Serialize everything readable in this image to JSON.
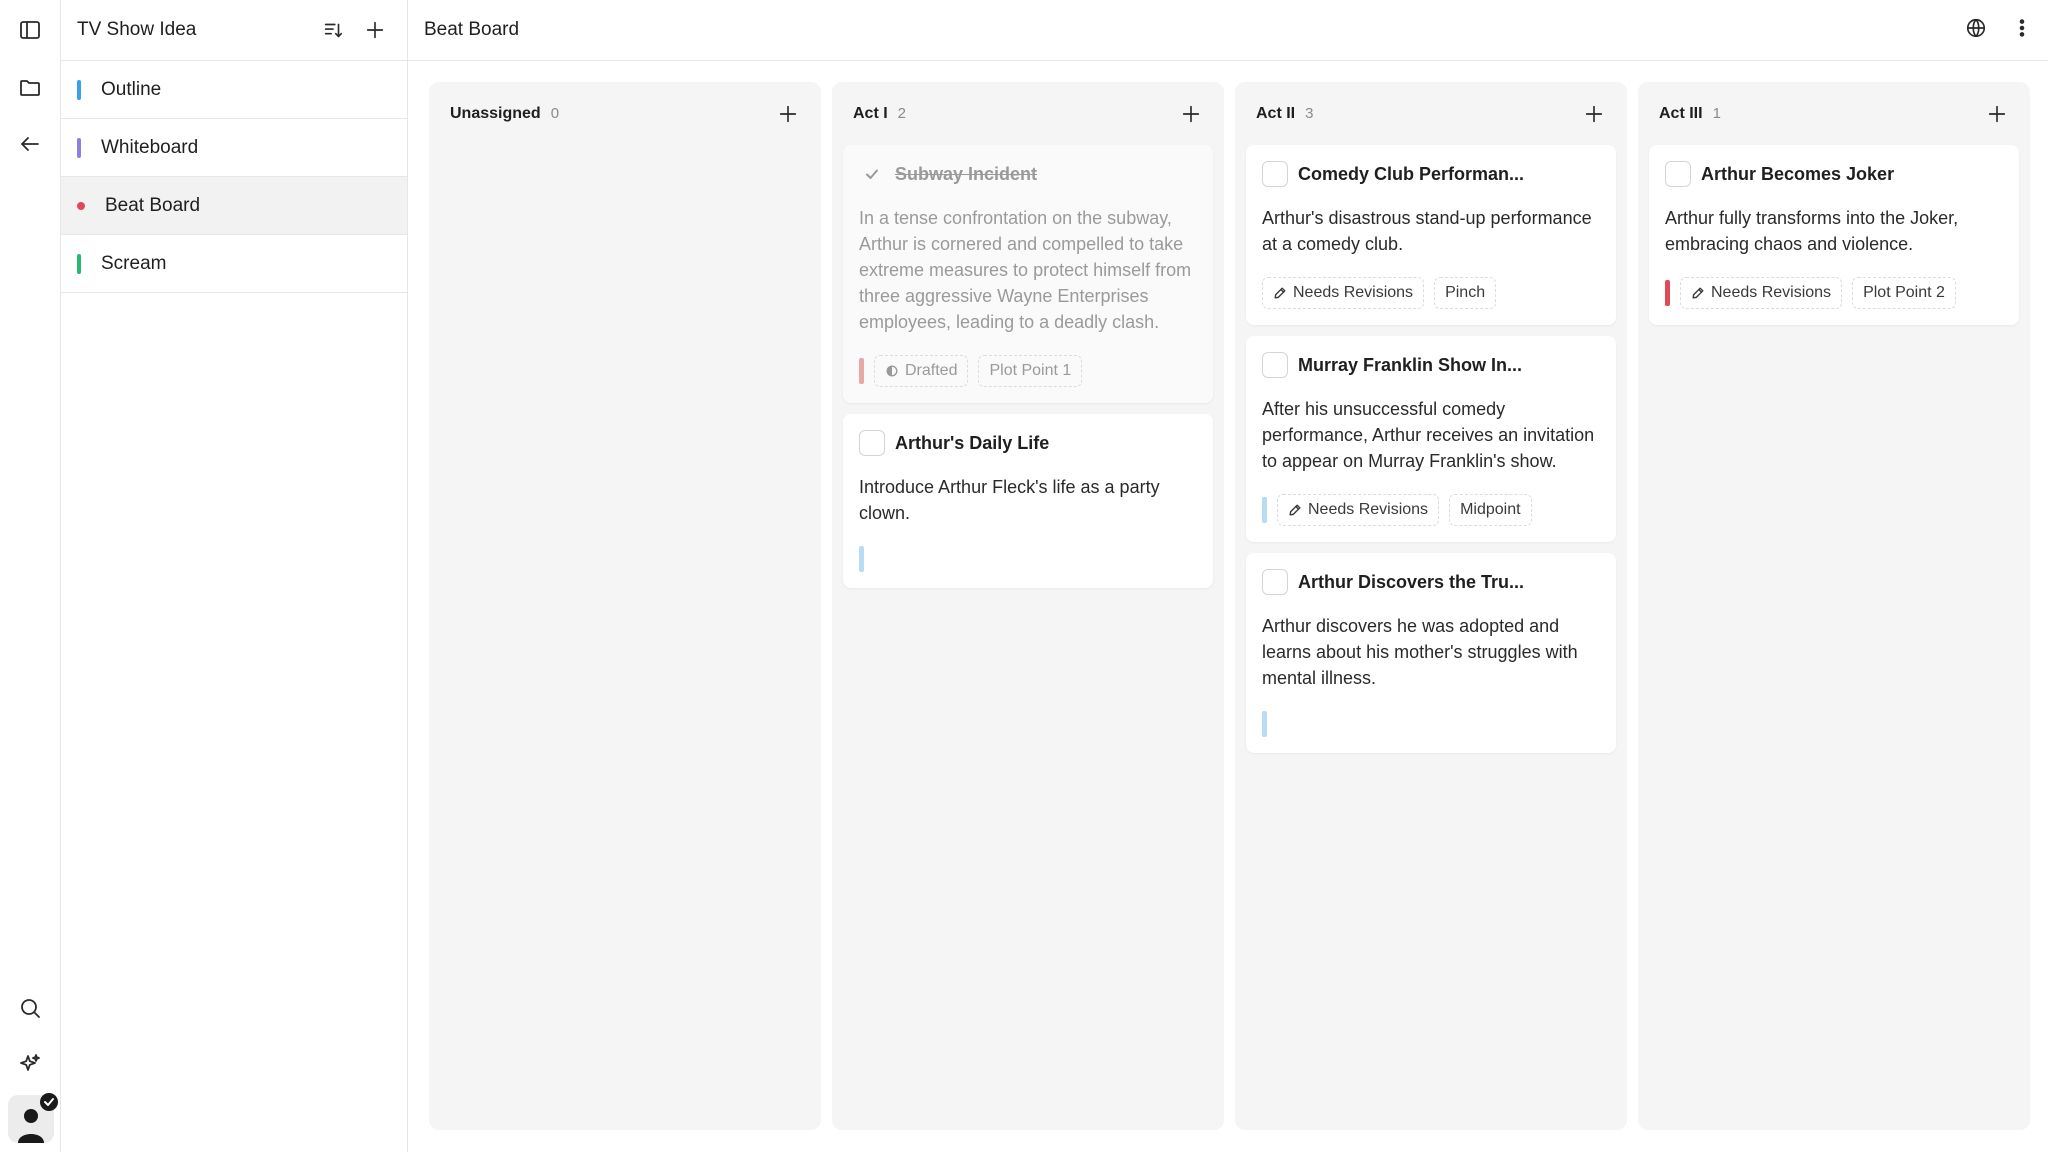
{
  "sidebar": {
    "project_title": "TV Show Idea",
    "items": [
      {
        "label": "Outline",
        "color": "#3aa0e8",
        "marker": "bar"
      },
      {
        "label": "Whiteboard",
        "color": "#8b7fe0",
        "marker": "bar"
      },
      {
        "label": "Beat Board",
        "color": "#e0495a",
        "marker": "dot",
        "active": true
      },
      {
        "label": "Scream",
        "color": "#2bb673",
        "marker": "bar"
      }
    ]
  },
  "header": {
    "title": "Beat Board"
  },
  "icons": {
    "rail": [
      "sidebar-toggle-icon",
      "folder-icon",
      "back-arrow-icon",
      "search-icon",
      "sparkle-icon",
      "user-avatar-icon"
    ],
    "panel": [
      "sort-icon",
      "plus-icon"
    ],
    "topbar": [
      "globe-icon",
      "more-vertical-icon"
    ]
  },
  "columns": [
    {
      "name": "Unassigned",
      "count": "0",
      "cards": []
    },
    {
      "name": "Act I",
      "count": "2",
      "cards": [
        {
          "title": "Subway Incident",
          "done": true,
          "desc": "In a tense confrontation on the subway, Arthur is cornered and compelled to take extreme measures to protect himself from three aggressive Wayne Enterprises employees, leading to a deadly clash.",
          "bar_color": "#e8a8a8",
          "tags": [
            {
              "label": "Drafted",
              "icon": "half-circle-icon"
            },
            {
              "label": "Plot Point 1"
            }
          ]
        },
        {
          "title": "Arthur's Daily Life",
          "done": false,
          "desc": "Introduce Arthur Fleck's life as a party clown.",
          "bar_color": "#b9dcf5",
          "tags": []
        }
      ]
    },
    {
      "name": "Act II",
      "count": "3",
      "cards": [
        {
          "title": "Comedy Club Performan...",
          "done": false,
          "desc": "Arthur's disastrous stand-up performance at a comedy club.",
          "bar_color": "",
          "tags": [
            {
              "label": "Needs Revisions",
              "icon": "pen-icon"
            },
            {
              "label": "Pinch"
            }
          ]
        },
        {
          "title": "Murray Franklin Show In...",
          "done": false,
          "desc": "After his unsuccessful comedy performance, Arthur receives an invitation to appear on Murray Franklin's show.",
          "bar_color": "#b9dcf5",
          "tags": [
            {
              "label": "Needs Revisions",
              "icon": "pen-icon"
            },
            {
              "label": "Midpoint"
            }
          ]
        },
        {
          "title": "Arthur Discovers the Tru...",
          "done": false,
          "desc": "Arthur discovers he was adopted and learns about his mother's struggles with mental illness.",
          "bar_color": "#b9dcf5",
          "tags": []
        }
      ]
    },
    {
      "name": "Act III",
      "count": "1",
      "cards": [
        {
          "title": "Arthur Becomes Joker",
          "done": false,
          "desc": "Arthur fully transforms into the Joker, embracing chaos and violence.",
          "bar_color": "#e0495a",
          "tags": [
            {
              "label": "Needs Revisions",
              "icon": "pen-icon"
            },
            {
              "label": "Plot Point 2"
            }
          ]
        }
      ]
    }
  ]
}
